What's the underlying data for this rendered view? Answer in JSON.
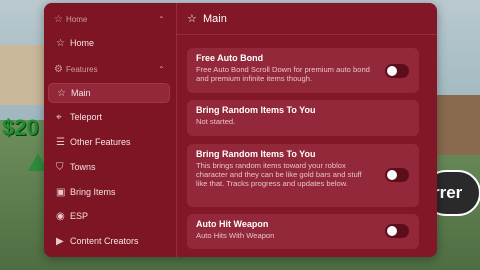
{
  "background": {
    "money_text": "$20",
    "button_text": "rrer"
  },
  "sidebar": {
    "sections": [
      {
        "label": "Home",
        "icon": "star-icon"
      },
      {
        "label": "Features",
        "icon": "gear-icon"
      }
    ],
    "items": [
      {
        "label": "Home",
        "icon": "star-icon"
      },
      {
        "label": "Main",
        "icon": "star-icon",
        "active": true
      },
      {
        "label": "Teleport",
        "icon": "location-pin-icon"
      },
      {
        "label": "Other Features",
        "icon": "list-icon"
      },
      {
        "label": "Towns",
        "icon": "shield-icon"
      },
      {
        "label": "Bring Items",
        "icon": "gift-icon"
      },
      {
        "label": "ESP",
        "icon": "eye-icon"
      },
      {
        "label": "Content Creators",
        "icon": "play-icon"
      }
    ]
  },
  "main": {
    "title": "Main",
    "cards": [
      {
        "title": "Free Auto Bond",
        "description": "Free Auto Bond Scroll Down for premium auto bond and premium infinite items though.",
        "toggle": false
      },
      {
        "title": "Bring Random Items To You",
        "description": "Not started."
      },
      {
        "title": "Bring Random Items To You",
        "description": "This brings random items toward your roblox character and they can be like gold bars and stuff like that. Tracks progress and updates below.",
        "toggle": false
      },
      {
        "title": "Auto Hit Weapon",
        "description": "Auto Hits With Weapon",
        "toggle": false
      }
    ]
  }
}
